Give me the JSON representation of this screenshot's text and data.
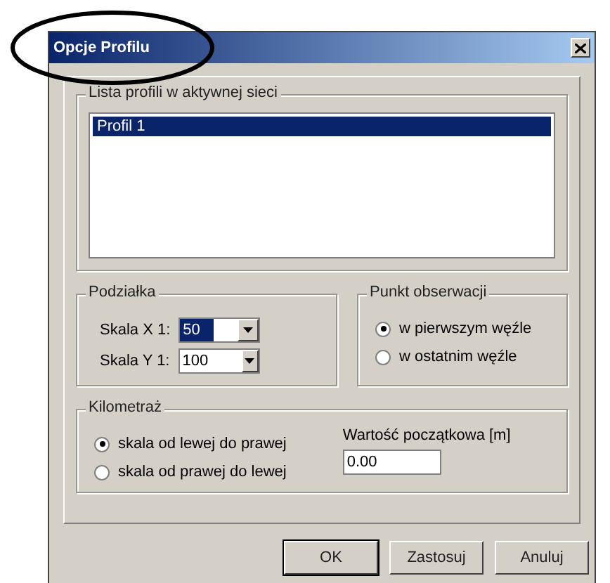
{
  "window": {
    "title": "Opcje Profilu"
  },
  "annotation": {
    "kind": "ellipse"
  },
  "profiles": {
    "label": "Lista profili w aktywnej sieci",
    "items": [
      {
        "name": "Profil 1",
        "selected": true
      }
    ]
  },
  "scale": {
    "label": "Podziałka",
    "fields": [
      {
        "label": "Skala X 1:",
        "value": "50",
        "selected": true
      },
      {
        "label": "Skala Y 1:",
        "value": "100",
        "selected": false
      }
    ]
  },
  "observation": {
    "label": "Punkt obserwacji",
    "options": [
      {
        "label": "w pierwszym węźle",
        "selected": true
      },
      {
        "label": "w ostatnim węźle",
        "selected": false
      }
    ]
  },
  "chainage": {
    "label": "Kilometraż",
    "options": [
      {
        "label": "skala od lewej do prawej",
        "selected": true
      },
      {
        "label": "skala od prawej do lewej",
        "selected": false
      }
    ],
    "start": {
      "label": "Wartość początkowa [m]",
      "value": "0.00"
    }
  },
  "buttons": [
    {
      "label": "OK",
      "default": true
    },
    {
      "label": "Zastosuj",
      "default": false
    },
    {
      "label": "Anuluj",
      "default": false
    }
  ]
}
